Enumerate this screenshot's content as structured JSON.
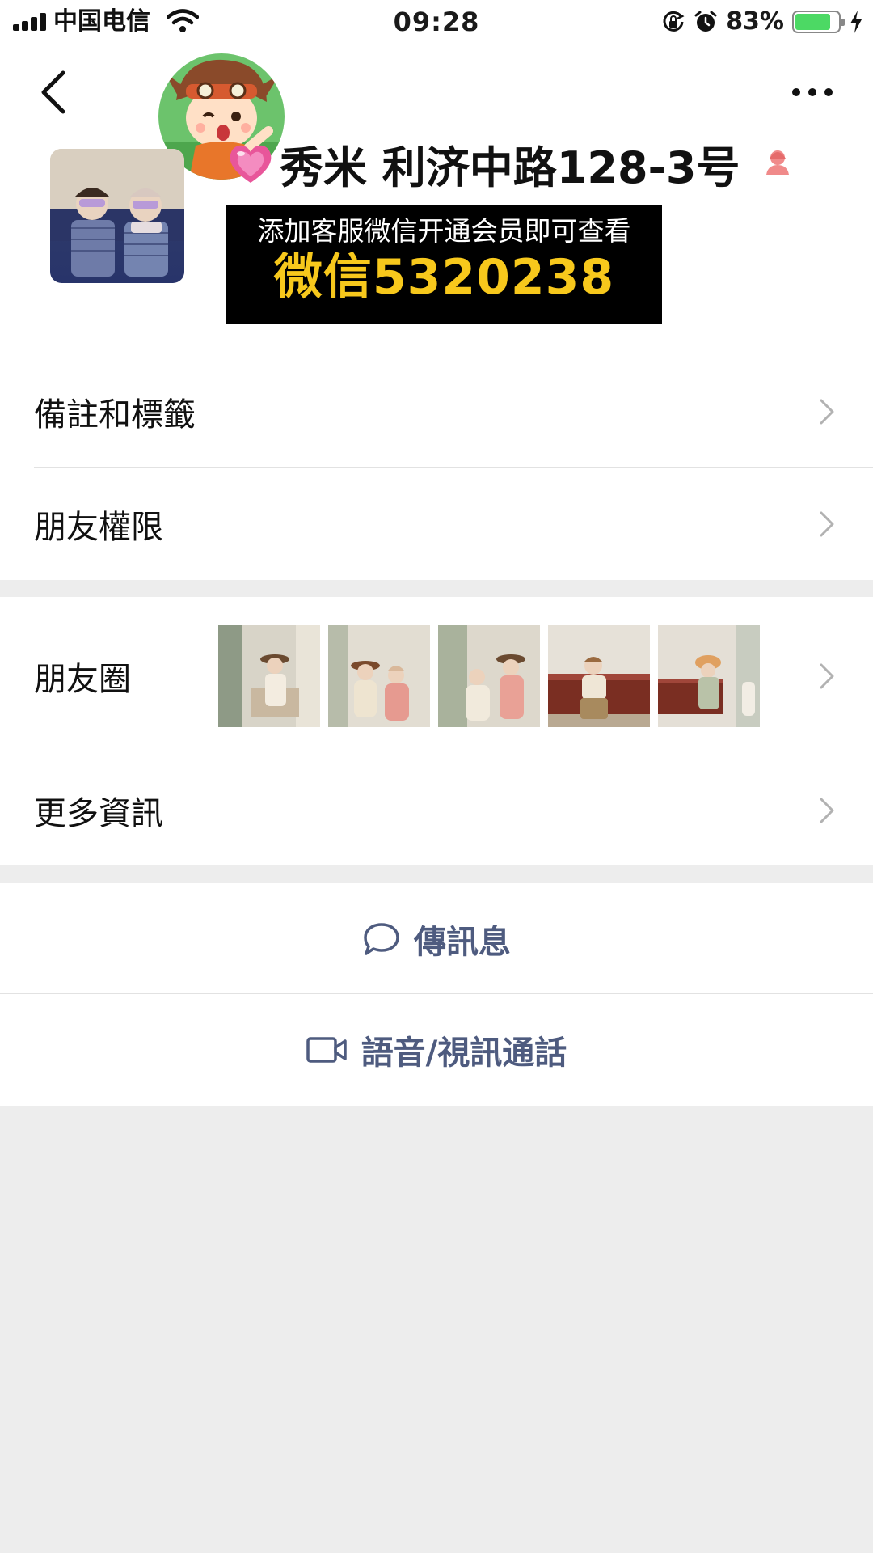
{
  "status_bar": {
    "carrier": "中国电信",
    "time": "09:28",
    "battery_percent": "83%",
    "battery_level": 0.83,
    "icons": [
      "signal-icon",
      "wifi-icon",
      "orientation-lock-icon",
      "alarm-icon",
      "battery-icon",
      "charging-bolt-icon"
    ]
  },
  "header": {
    "back_icon": "chevron-left-icon",
    "more_icon": "more-dots-icon"
  },
  "profile": {
    "name": "秀米 利济中路128-3号",
    "name_prefix_icon": "pink-heart-icon",
    "gender_icon": "female-icon",
    "promo": {
      "line1": "添加客服微信开通会员即可查看",
      "line2": "微信5320238"
    }
  },
  "menu": {
    "remarks_tags": "備註和標籤",
    "friend_permissions": "朋友權限",
    "moments": "朋友圈",
    "more_info": "更多資訊"
  },
  "actions": {
    "send_message": "傳訊息",
    "voice_video_call": "語音/視訊通話"
  },
  "colors": {
    "accent_link": "#4e5b7f",
    "promo_yellow": "#f7c81c",
    "battery_green": "#4cd964",
    "page_bg": "#ededed"
  }
}
